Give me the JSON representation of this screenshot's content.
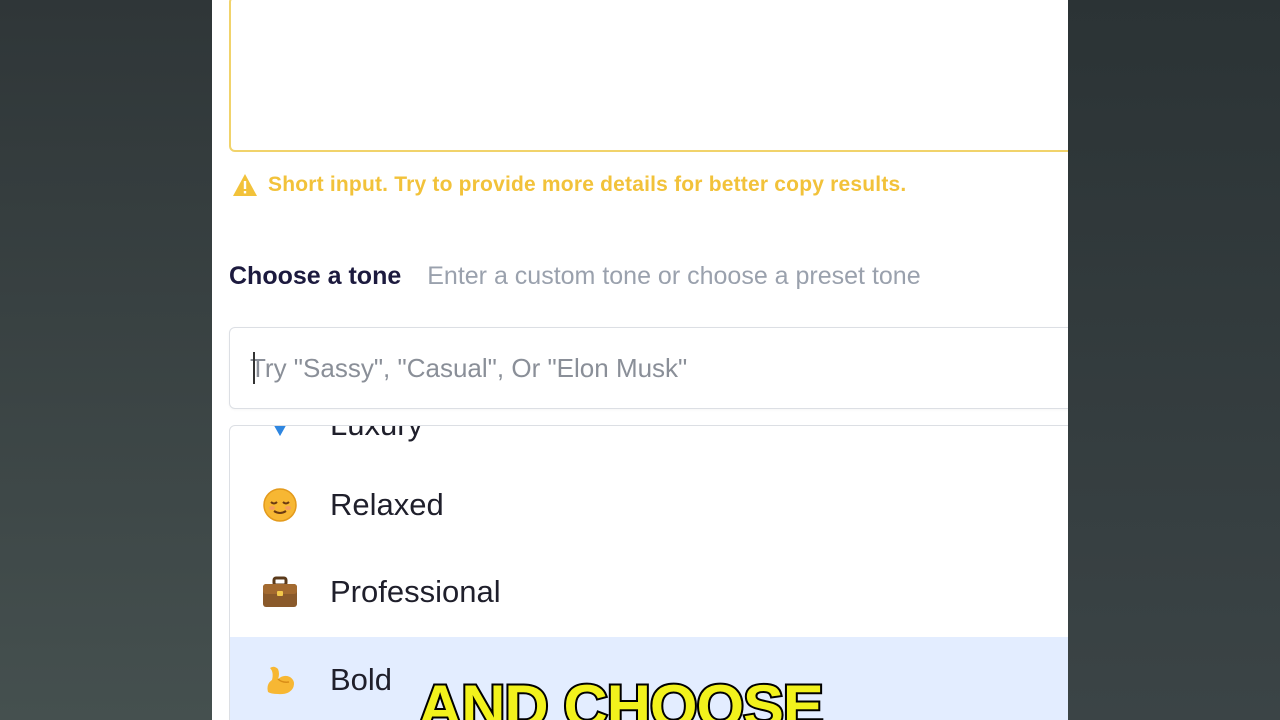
{
  "description_box": {
    "value": ""
  },
  "warning": {
    "icon": "warning-triangle-icon",
    "text": "Short input. Try to provide more details for better copy results.",
    "color": "#f2c23a"
  },
  "tone": {
    "title": "Choose a tone",
    "hint": "Enter a custom tone or choose a preset tone",
    "input": {
      "value": "",
      "placeholder": "Try \"Sassy\", \"Casual\", Or \"Elon Musk\""
    },
    "options": [
      {
        "label": "Luxury",
        "icon": "diamond-icon"
      },
      {
        "label": "Relaxed",
        "icon": "relieved-face-icon"
      },
      {
        "label": "Professional",
        "icon": "briefcase-icon"
      },
      {
        "label": "Bold",
        "icon": "flexed-biceps-icon",
        "highlighted": true
      }
    ]
  },
  "overlay_caption": "AND CHOOSE",
  "colors": {
    "accent_border": "#f1d36b",
    "title": "#1c1a3e",
    "highlight": "#e3edff",
    "caption": "#f2f21c"
  }
}
